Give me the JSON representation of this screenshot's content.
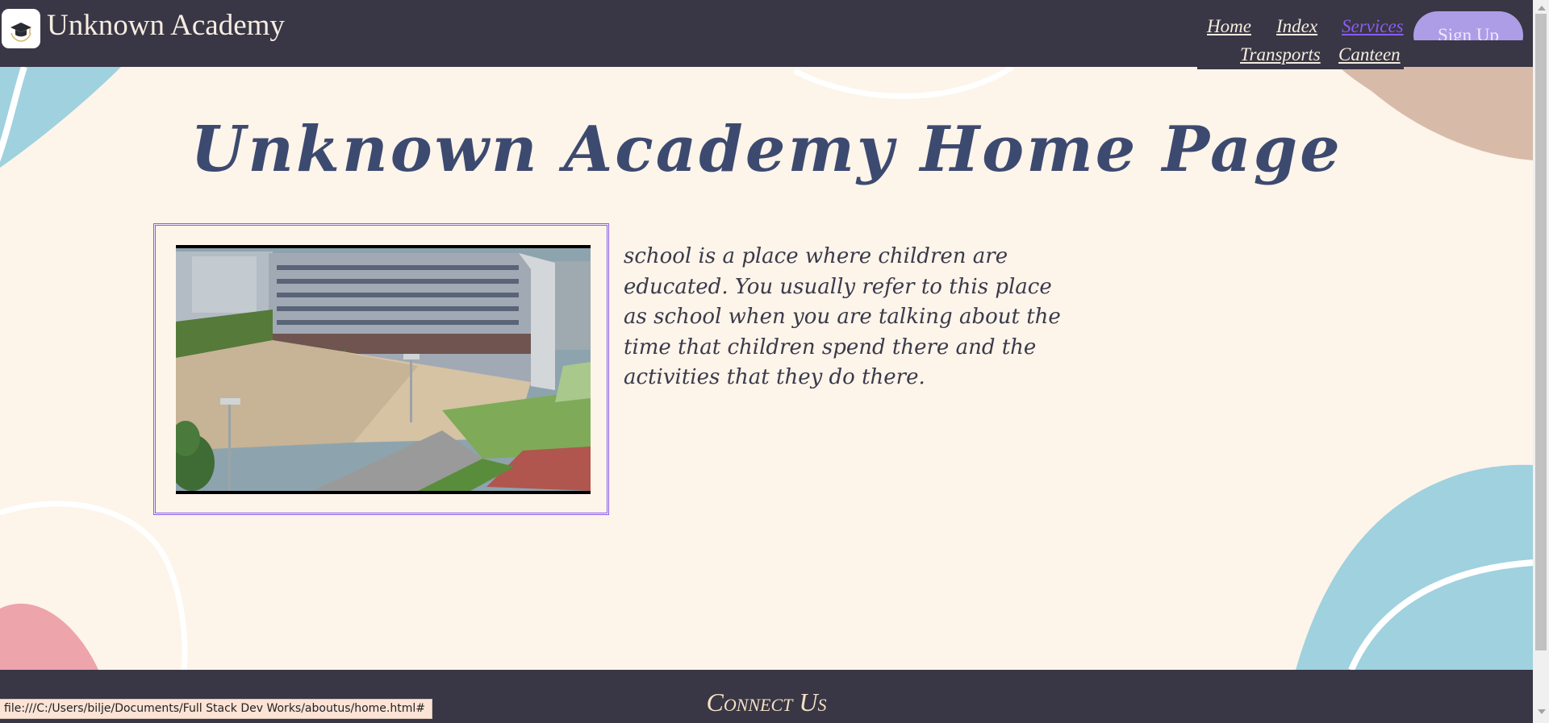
{
  "header": {
    "site_title": "Unknown Academy",
    "nav": {
      "home": "Home",
      "index": "Index",
      "services": "Services",
      "transports": "Transports",
      "canteen": "Canteen"
    },
    "signup_label": "Sign Up"
  },
  "main": {
    "page_title": "Unknown Academy Home Page",
    "intro_text": "school is a place where children are educated. You usually refer to this place as school when you are talking about the time that children spend there and the activities that they do there."
  },
  "footer": {
    "title": "Connect Us"
  },
  "browser": {
    "status_url": "file:///C:/Users/bilje/Documents/Full Stack Dev Works/aboutus/home.html#"
  },
  "colors": {
    "header_bg": "#393645",
    "page_bg": "#fdf4ea",
    "accent_purple": "#8a5cf0",
    "signup_bg": "#ad9de6",
    "title_text": "#3d4a70",
    "decor_blue": "#9fd1df",
    "decor_tan": "#d7bba8",
    "decor_pink": "#eda4aa"
  },
  "icons": {
    "logo": "graduation-cap-icon"
  }
}
